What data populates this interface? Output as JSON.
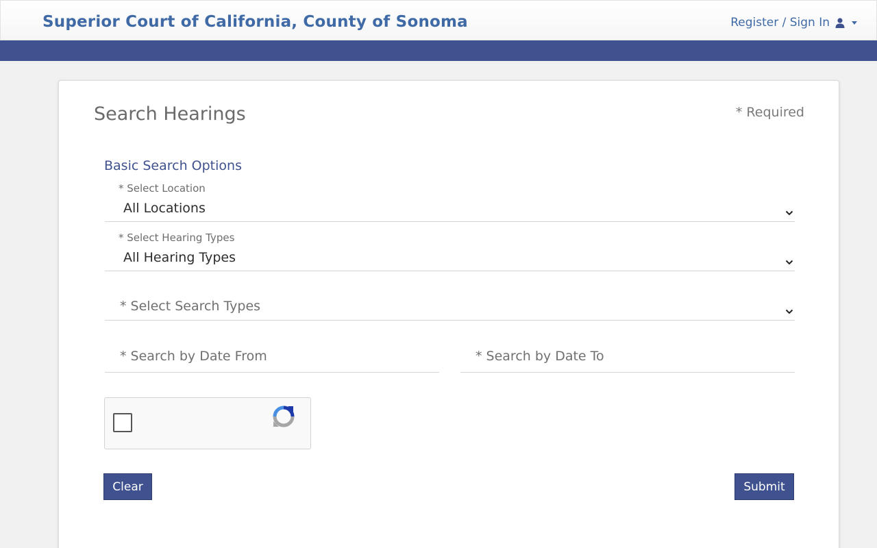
{
  "header": {
    "title": "Superior Court of California, County of Sonoma",
    "signin_label": "Register / Sign In",
    "user_icon": "user-icon",
    "accent_color": "#3f6aa6",
    "bar_color": "#3f518e"
  },
  "form": {
    "title": "Search Hearings",
    "required_note": "* Required",
    "section_title": "Basic Search Options",
    "location": {
      "label": "* Select Location",
      "value": "All Locations"
    },
    "hearing_types": {
      "label": "* Select Hearing Types",
      "value": "All Hearing Types"
    },
    "search_types": {
      "placeholder": "* Select Search Types"
    },
    "date_from": {
      "placeholder": "* Search by Date From"
    },
    "date_to": {
      "placeholder": "* Search by Date To"
    },
    "clear_label": "Clear",
    "submit_label": "Submit"
  }
}
